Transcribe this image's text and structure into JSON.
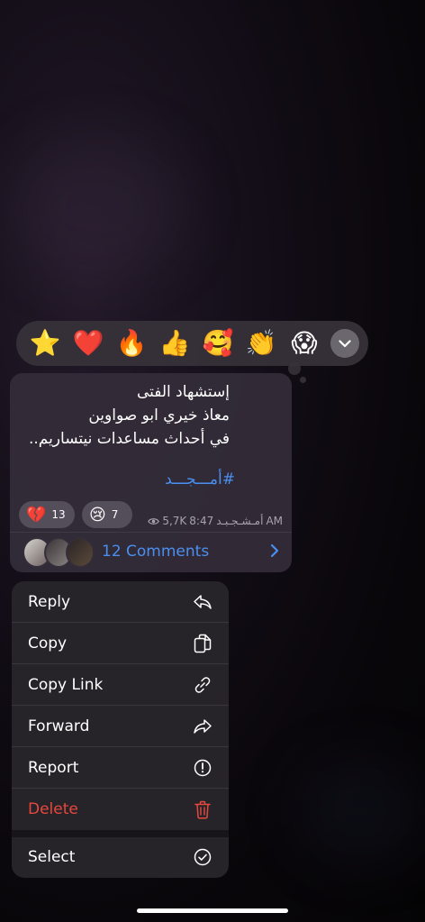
{
  "reactions_bar": {
    "emojis": [
      "⭐",
      "❤️",
      "🔥",
      "👍",
      "🥰",
      "👏",
      "😱"
    ]
  },
  "message": {
    "lines": [
      "إستشهاد الفتى",
      "معاذ خيري ابو صواوين",
      "في أحداث مساعدات نيتساريم.."
    ],
    "hashtag": "#أمـــجـــد",
    "reactions": [
      {
        "emoji": "💔",
        "count": "13"
      },
      {
        "emoji": "😢",
        "count": "7"
      }
    ],
    "views": "5,7K",
    "time": "8:47",
    "author": "أمـشـجـبـد",
    "am_label": "AM",
    "comments_label": "12 Comments"
  },
  "menu": {
    "items": [
      {
        "label": "Reply",
        "icon": "reply-icon"
      },
      {
        "label": "Copy",
        "icon": "copy-icon"
      },
      {
        "label": "Copy Link",
        "icon": "link-icon"
      },
      {
        "label": "Forward",
        "icon": "forward-icon"
      },
      {
        "label": "Report",
        "icon": "report-icon"
      },
      {
        "label": "Delete",
        "icon": "trash-icon"
      },
      {
        "label": "Select",
        "icon": "checkmark-circle-icon"
      }
    ],
    "danger_color": "#e5483e"
  },
  "colors": {
    "accent": "#4a8ff0",
    "bubble": "#342d3a",
    "menu_bg": "#262428"
  }
}
